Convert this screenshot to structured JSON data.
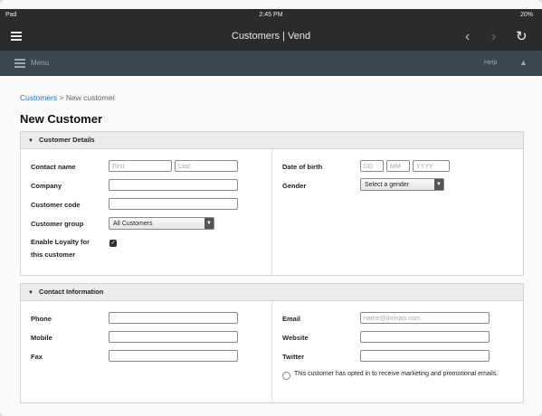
{
  "status": {
    "device": "Pad",
    "time": "2:45 PM",
    "battery": "20%"
  },
  "titlebar": {
    "title": "Customers | Vend"
  },
  "menubar": {
    "menu_label": "Menu",
    "help_label": "Help"
  },
  "breadcrumb": {
    "link": "Customers",
    "separator": ">",
    "current": "New customer"
  },
  "page_title": "New Customer",
  "customer_details": {
    "heading": "Customer Details",
    "contact_name_label": "Contact name",
    "first_placeholder": "First",
    "last_placeholder": "Last",
    "company_label": "Company",
    "customer_code_label": "Customer code",
    "customer_group_label": "Customer group",
    "customer_group_value": "All Customers",
    "loyalty_label_1": "Enable Loyalty for",
    "loyalty_label_2": "this customer",
    "dob_label": "Date of birth",
    "dob_dd": "DD",
    "dob_mm": "MM",
    "dob_yyyy": "YYYY",
    "gender_label": "Gender",
    "gender_value": "Select a gender"
  },
  "contact_information": {
    "heading": "Contact Information",
    "phone_label": "Phone",
    "mobile_label": "Mobile",
    "fax_label": "Fax",
    "email_label": "Email",
    "email_placeholder": "name@domain.com",
    "website_label": "Website",
    "twitter_label": "Twitter",
    "optin_text": "This customer has opted in to receive marketing and promotional emails."
  }
}
